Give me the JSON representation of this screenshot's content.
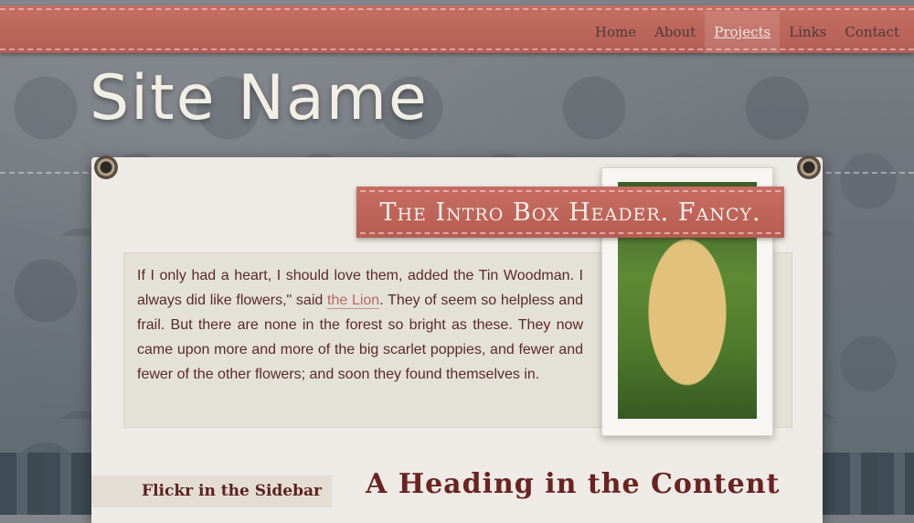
{
  "site": {
    "name": "Site Name"
  },
  "nav": {
    "items": [
      {
        "label": "Home"
      },
      {
        "label": "About"
      },
      {
        "label": "Projects",
        "active": true
      },
      {
        "label": "Links"
      },
      {
        "label": "Contact"
      }
    ]
  },
  "intro": {
    "header": "The Intro Box Header. Fancy.",
    "text_before": "If I only had a heart, I should love them, added the Tin Woodman. I always did like flowers,\" said ",
    "link_text": "the Lion",
    "text_after": ". They of seem so helpless and frail.  But there are none in the forest so bright as these. They now came upon more and more of the big scarlet poppies, and fewer and fewer of the other flowers; and soon they found themselves in."
  },
  "sidebar": {
    "heading": "Flickr in the Sidebar"
  },
  "content": {
    "heading": "A Heading in the Content"
  },
  "colors": {
    "nav_band": "#b45e55",
    "paper": "#eeebe6",
    "heading_text": "#6a2320",
    "link": "#b56a62"
  }
}
